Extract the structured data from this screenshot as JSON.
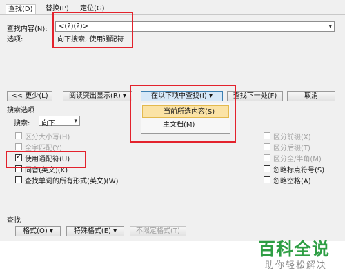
{
  "tabs": [
    "查找(D)",
    "替换(P)",
    "定位(G)"
  ],
  "find": {
    "label": "查找内容(N):",
    "value": "<(?)(?)>",
    "options_label": "选项:",
    "options_value": "向下搜索, 使用通配符"
  },
  "buttons": {
    "less": "<< 更少(L)",
    "highlight": "阅读突出显示(R) ▾",
    "find_in": "在以下项中查找(I) ▾",
    "find_next": "查找下一处(F)",
    "cancel": "取消"
  },
  "menu": {
    "items": [
      "当前所选内容(S)",
      "主文档(M)"
    ]
  },
  "search_options": {
    "title": "搜索选项",
    "search_label": "搜索:",
    "search_value": "向下"
  },
  "left_checks": [
    {
      "label": "区分大小写(H)",
      "checked": false,
      "enabled": false
    },
    {
      "label": "全字匹配(Y)",
      "checked": false,
      "enabled": false
    },
    {
      "label": "使用通配符(U)",
      "checked": true,
      "enabled": true
    },
    {
      "label": "同音(英文)(K)",
      "checked": false,
      "enabled": true
    },
    {
      "label": "查找单词的所有形式(英文)(W)",
      "checked": false,
      "enabled": true
    }
  ],
  "right_checks": [
    {
      "label": "区分前缀(X)",
      "checked": false,
      "enabled": false
    },
    {
      "label": "区分后缀(T)",
      "checked": false,
      "enabled": false
    },
    {
      "label": "区分全/半角(M)",
      "checked": false,
      "enabled": false
    },
    {
      "label": "忽略标点符号(S)",
      "checked": false,
      "enabled": true
    },
    {
      "label": "忽略空格(A)",
      "checked": false,
      "enabled": true
    }
  ],
  "find_section": {
    "title": "查找",
    "format": "格式(O) ▾",
    "special": "特殊格式(E) ▾",
    "no_format": "不限定格式(T)"
  },
  "watermark": {
    "main": "百科全说",
    "sub": "助你轻松解决"
  }
}
